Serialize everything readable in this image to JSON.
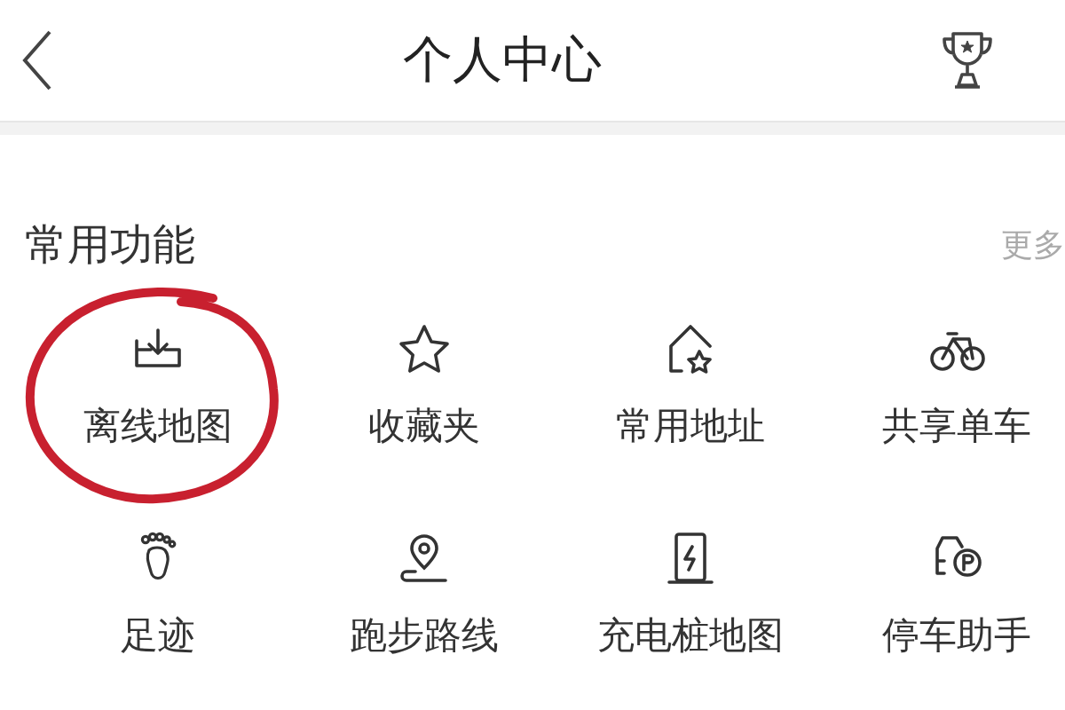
{
  "header": {
    "title": "个人中心"
  },
  "section": {
    "title": "常用功能",
    "more": "更多"
  },
  "items": [
    {
      "kind": "download",
      "label": "离线地图",
      "circled": true
    },
    {
      "kind": "star",
      "label": "收藏夹",
      "circled": false
    },
    {
      "kind": "home",
      "label": "常用地址",
      "circled": false
    },
    {
      "kind": "bike",
      "label": "共享单车",
      "circled": false
    },
    {
      "kind": "foot",
      "label": "足迹",
      "circled": false
    },
    {
      "kind": "pin",
      "label": "跑步路线",
      "circled": false
    },
    {
      "kind": "charger",
      "label": "充电桩地图",
      "circled": false
    },
    {
      "kind": "parking",
      "label": "停车助手",
      "circled": false
    }
  ]
}
